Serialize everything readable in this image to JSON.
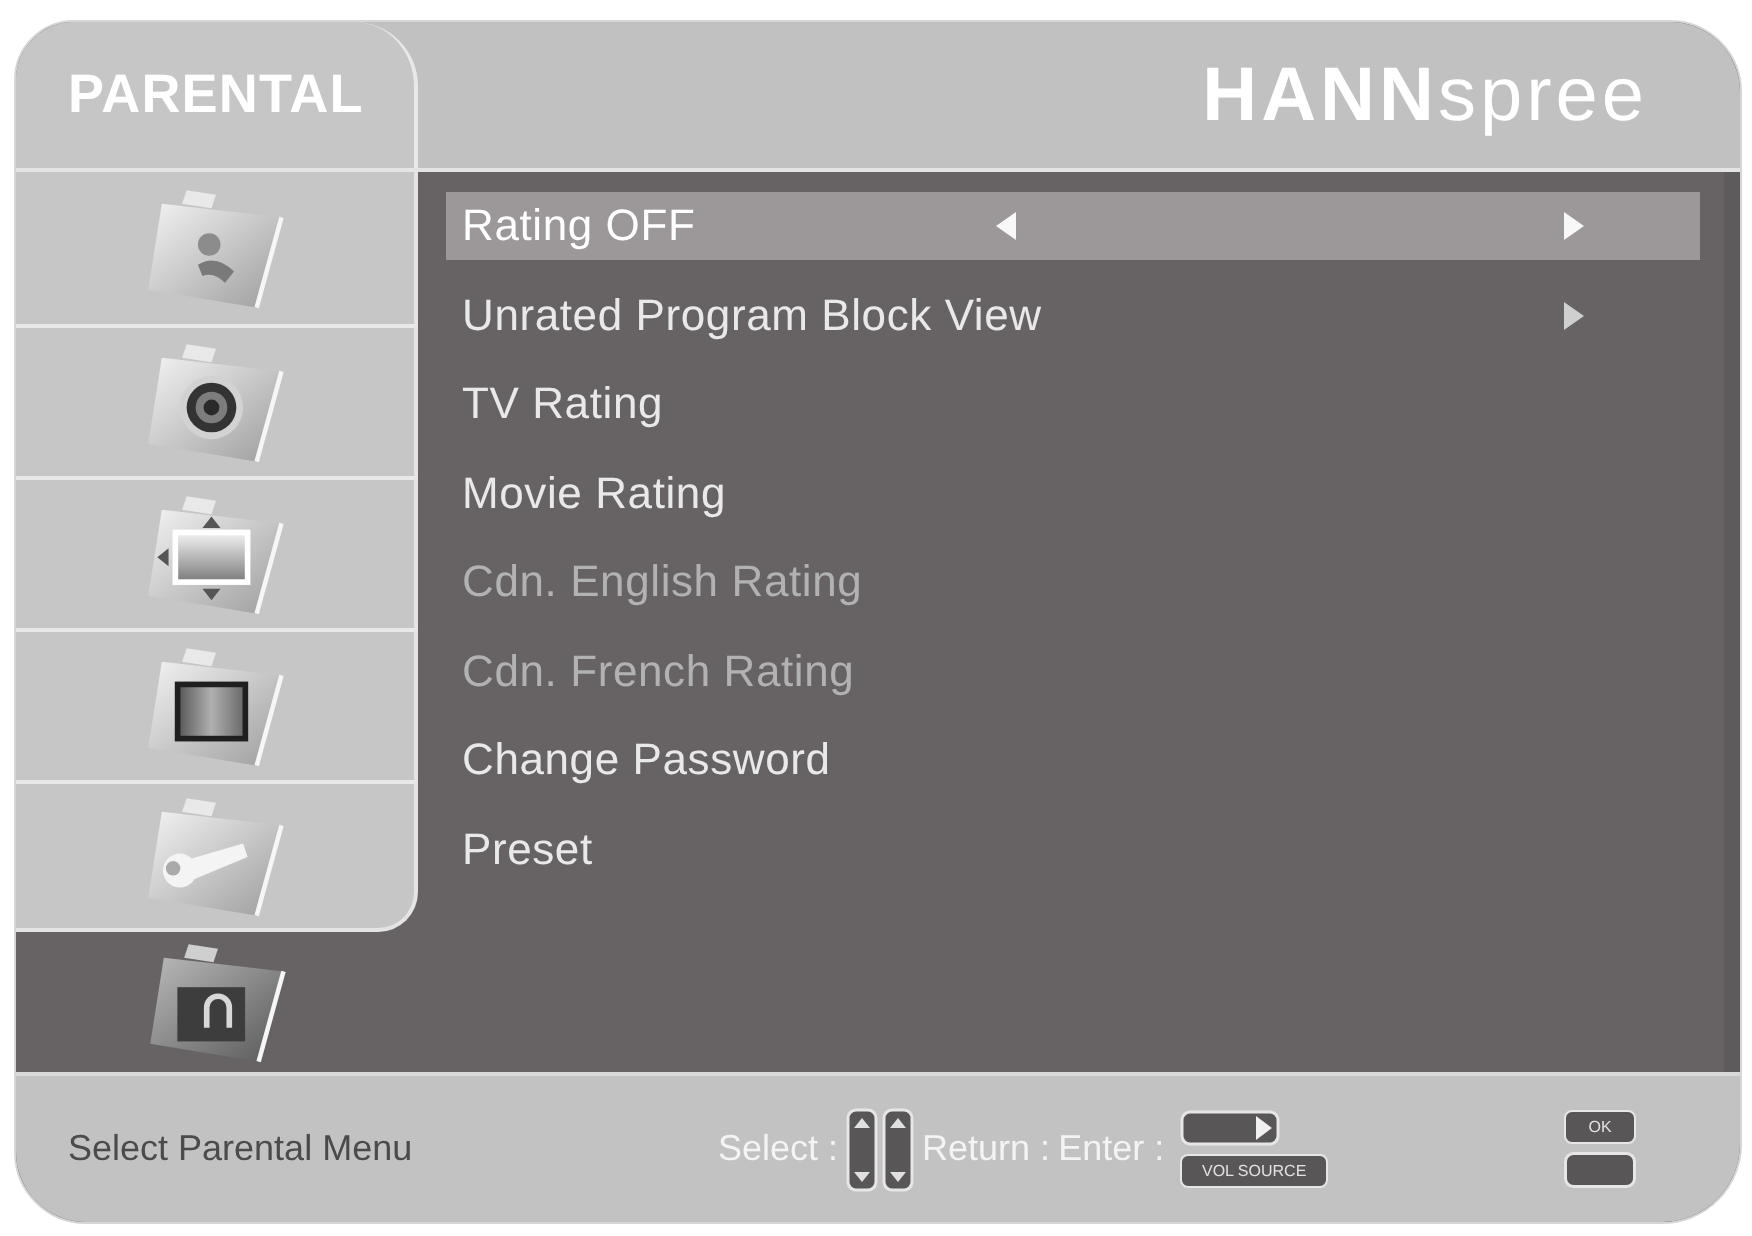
{
  "header": {
    "title": "PARENTAL",
    "logo": "**HANN**spree"
  },
  "sidebar": {
    "items": [
      {
        "selected": false
      },
      {
        "selected": false
      },
      {
        "selected": false
      },
      {
        "selected": false
      },
      {
        "selected": false
      },
      {
        "selected": true
      }
    ]
  },
  "menu": {
    "items": [
      {
        "label": "Rating OFF",
        "kind": "option",
        "selected": true,
        "disabled": false
      },
      {
        "label": "Unrated Program Block View",
        "kind": "submenu",
        "selected": false,
        "disabled": false
      },
      {
        "label": "TV Rating",
        "kind": "plain",
        "selected": false,
        "disabled": false
      },
      {
        "label": "Movie Rating",
        "kind": "plain",
        "selected": false,
        "disabled": false
      },
      {
        "label": "Cdn. English Rating",
        "kind": "plain",
        "selected": false,
        "disabled": true
      },
      {
        "label": "Cdn. French Rating",
        "kind": "plain",
        "selected": false,
        "disabled": true
      },
      {
        "label": "Change Password",
        "kind": "plain",
        "selected": false,
        "disabled": false
      },
      {
        "label": "Preset",
        "kind": "plain",
        "selected": false,
        "disabled": false
      }
    ]
  },
  "footer": {
    "hint": "Select Parental Menu",
    "select_label": "Select :",
    "return_label": "Return :",
    "enter_label": "Enter :",
    "source_key": "VOL SOURCE",
    "ok_key": "OK"
  }
}
